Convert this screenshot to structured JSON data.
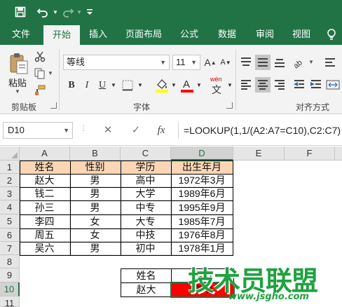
{
  "ribbon_tabs": [
    "文件",
    "开始",
    "插入",
    "页面布局",
    "公式",
    "数据",
    "审阅",
    "视图"
  ],
  "ribbon": {
    "paste_label": "粘贴",
    "clipboard_label": "剪贴板",
    "font_group_label": "字体",
    "align_group_label": "对齐方式",
    "font_name": "等线",
    "font_size": "11",
    "phonetic_label": "wén"
  },
  "formula_bar": {
    "name_box": "D10",
    "fx_label": "fx",
    "formula": "=LOOKUP(1,1/(A2:A7=C10),C2:C7)"
  },
  "columns": [
    "A",
    "B",
    "C",
    "D",
    "E",
    "F"
  ],
  "rows": [
    "1",
    "2",
    "3",
    "4",
    "5",
    "6",
    "7",
    "8",
    "9",
    "10",
    "11"
  ],
  "table": {
    "headers": [
      "姓名",
      "性别",
      "学历",
      "出生年月"
    ],
    "rows": [
      [
        "赵大",
        "男",
        "高中",
        "1972年3月"
      ],
      [
        "钱二",
        "男",
        "大学",
        "1989年6月"
      ],
      [
        "孙三",
        "男",
        "中专",
        "1995年9月"
      ],
      [
        "李四",
        "女",
        "大专",
        "1985年7月"
      ],
      [
        "周五",
        "女",
        "中技",
        "1976年8月"
      ],
      [
        "吴六",
        "男",
        "初中",
        "1978年1月"
      ]
    ]
  },
  "lookup": {
    "c9": "姓名",
    "d9": "学历",
    "c10": "赵大",
    "d10": "高中"
  },
  "watermark": {
    "main": "技术员联盟",
    "sub": "www.jsgho.com"
  },
  "colors": {
    "excel_green": "#217346",
    "header_fill": "#fcd5b4",
    "result_fill": "#ff0000",
    "watermark": "#1fa23f"
  },
  "icons": [
    "save-icon",
    "undo-icon",
    "redo-icon",
    "customize-qat-icon",
    "help-bulb-icon",
    "paste-icon",
    "cut-icon",
    "copy-icon",
    "format-painter-icon",
    "fill-color-icon",
    "font-color-icon",
    "cancel-icon",
    "enter-icon"
  ]
}
